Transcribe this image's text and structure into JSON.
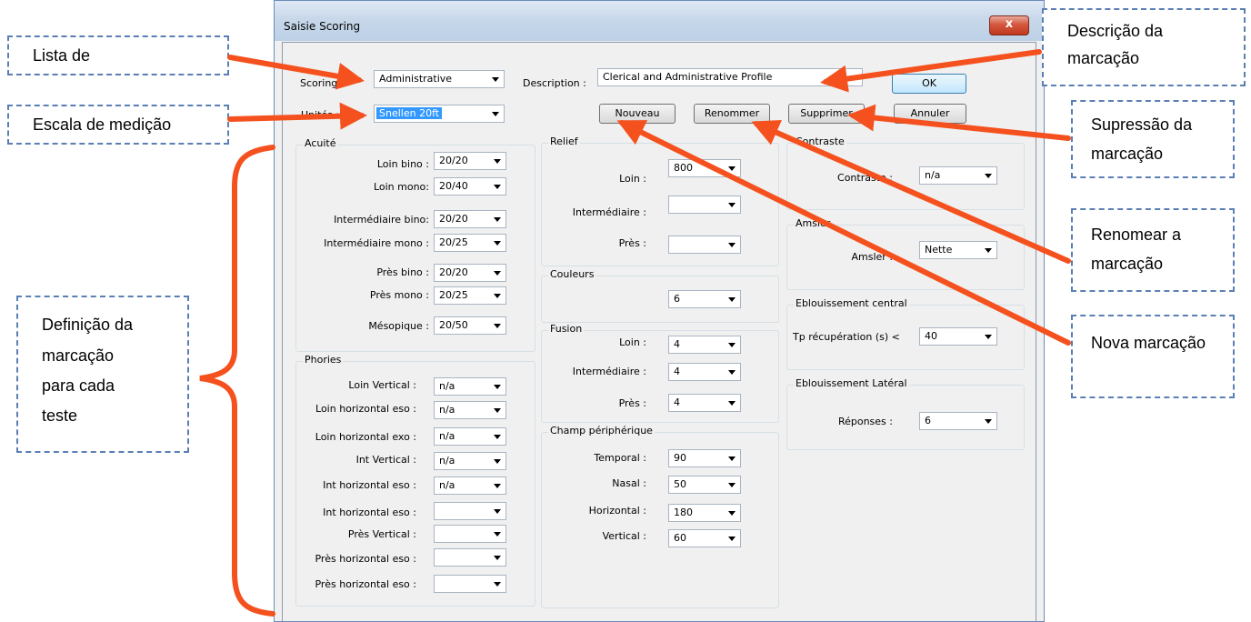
{
  "window": {
    "title": "Saisie Scoring",
    "close_glyph": "x"
  },
  "top": {
    "scoring_label": "Scoring :",
    "scoring_value": "Administrative",
    "description_label": "Description :",
    "description_value": "Clerical and Administrative Profile",
    "units_label": "Unités :",
    "units_value": "Snellen 20ft",
    "ok": "OK",
    "nouveau": "Nouveau",
    "renommer": "Renommer",
    "supprimer": "Supprimer",
    "annuler": "Annuler"
  },
  "acuite": {
    "title": "Acuité",
    "rows": [
      {
        "label": "Loin bino :",
        "value": "20/20"
      },
      {
        "label": "Loin mono:",
        "value": "20/40"
      },
      {
        "label": "Intermédiaire bino:",
        "value": "20/20"
      },
      {
        "label": "Intermédiaire mono :",
        "value": "20/25"
      },
      {
        "label": "Près bino :",
        "value": "20/20"
      },
      {
        "label": "Près mono :",
        "value": "20/25"
      },
      {
        "label": "Mésopique :",
        "value": "20/50"
      }
    ]
  },
  "phories": {
    "title": "Phories",
    "rows": [
      {
        "label": "Loin Vertical :",
        "value": "n/a"
      },
      {
        "label": "Loin horizontal eso :",
        "value": "n/a"
      },
      {
        "label": "Loin horizontal exo :",
        "value": "n/a"
      },
      {
        "label": "Int Vertical :",
        "value": "n/a"
      },
      {
        "label": "Int horizontal eso :",
        "value": "n/a"
      },
      {
        "label": "Int horizontal eso :",
        "value": ""
      },
      {
        "label": "Près Vertical :",
        "value": ""
      },
      {
        "label": "Près horizontal eso :",
        "value": ""
      },
      {
        "label": "Près horizontal eso :",
        "value": ""
      }
    ]
  },
  "relief": {
    "title": "Relief",
    "rows": [
      {
        "label": "Loin :",
        "value": "800"
      },
      {
        "label": "Intermédiaire :",
        "value": ""
      },
      {
        "label": "Près :",
        "value": ""
      }
    ]
  },
  "couleurs": {
    "title": "Couleurs",
    "value": "6"
  },
  "fusion": {
    "title": "Fusion",
    "rows": [
      {
        "label": "Loin :",
        "value": "4"
      },
      {
        "label": "Intermédiaire :",
        "value": "4"
      },
      {
        "label": "Près :",
        "value": "4"
      }
    ]
  },
  "champ": {
    "title": "Champ périphérique",
    "rows": [
      {
        "label": "Temporal :",
        "value": "90"
      },
      {
        "label": "Nasal :",
        "value": "50"
      },
      {
        "label": "Horizontal :",
        "value": "180"
      },
      {
        "label": "Vertical :",
        "value": "60"
      }
    ]
  },
  "contraste": {
    "title": "Contraste",
    "label": "Contraste :",
    "value": "n/a"
  },
  "amsler": {
    "title": "Amsler",
    "label": "Amsler :",
    "value": "Nette"
  },
  "ebl_central": {
    "title": "Eblouissement central",
    "label": "Tp récupération (s) <",
    "value": "40"
  },
  "ebl_lateral": {
    "title": "Eblouissement Latéral",
    "label": "Réponses :",
    "value": "6"
  },
  "callouts": {
    "lista": "Lista de",
    "escala": "Escala de medição",
    "definicao": [
      "Definição da",
      "marcação",
      "para cada",
      "teste"
    ],
    "descricao": [
      "Descrição da",
      "marcação"
    ],
    "supressao": [
      "Supressão da",
      "marcação"
    ],
    "renomear": [
      "Renomear a",
      "marcação"
    ],
    "nova": "Nova marcação"
  },
  "colors": {
    "arrow": "#f4511e",
    "callout_border": "#5b7fb5"
  }
}
